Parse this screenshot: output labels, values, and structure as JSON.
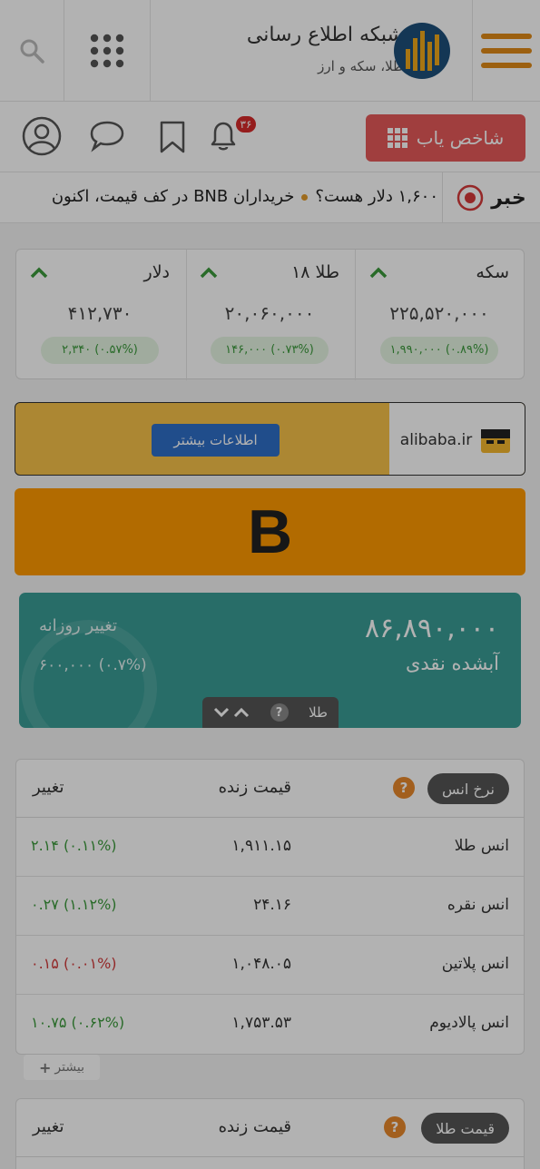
{
  "header": {
    "title": "شبکه اطلاع رسانی",
    "subtitle": "طلا، سکه و ارز"
  },
  "toolbar": {
    "finder_label": "شاخص یاب",
    "notif_count": "۳۶"
  },
  "ticker": {
    "label": "خبر",
    "headline_1": "۱,۶۰۰ دلار هست؟",
    "headline_2": "خریداران BNB در کف قیمت، اکنون"
  },
  "summary": [
    {
      "name": "سکه",
      "value": "۲۲۵,۵۲۰,۰۰۰",
      "change": "۱,۹۹۰,۰۰۰ (۰.۸۹%)"
    },
    {
      "name": "طلا ۱۸",
      "value": "۲۰,۰۶۰,۰۰۰",
      "change": "۱۴۶,۰۰۰ (۰.۷۳%)"
    },
    {
      "name": "دلار",
      "value": "۴۱۲,۷۳۰",
      "change": "۲,۳۴۰ (۰.۵۷%)"
    }
  ],
  "ad": {
    "brand": "alibaba.ir",
    "button": "اطلاعات بیشتر"
  },
  "banner": {
    "letter": "B"
  },
  "highlight": {
    "value": "۸۶,۸۹۰,۰۰۰",
    "name": "آبشده نقدی",
    "change_label": "تغییر روزانه",
    "change_value": "۶۰۰,۰۰۰ (۰.۷%)",
    "category": "طلا"
  },
  "ounce_table": {
    "title": "نرخ انس",
    "col_live": "قیمت زنده",
    "col_change": "تغییر",
    "rows": [
      {
        "name": "انس طلا",
        "price": "۱,۹۱۱.۱۵",
        "change": "۲.۱۴ (۰.۱۱%)",
        "dir": "pos"
      },
      {
        "name": "انس نقره",
        "price": "۲۴.۱۶",
        "change": "۰.۲۷ (۱.۱۲%)",
        "dir": "pos"
      },
      {
        "name": "انس پلاتین",
        "price": "۱,۰۴۸.۰۵",
        "change": "۰.۱۵ (۰.۰۱%)",
        "dir": "neg"
      },
      {
        "name": "انس پالادیوم",
        "price": "۱,۷۵۳.۵۳",
        "change": "۱۰.۷۵ (۰.۶۲%)",
        "dir": "pos"
      }
    ]
  },
  "more_label": "بیشتر",
  "gold_table": {
    "title": "قیمت طلا",
    "col_live": "قیمت زنده",
    "col_change": "تغییر"
  },
  "colors": {
    "accent_red": "#e55a5a",
    "teal": "#3a9c96",
    "banner": "#ff9a00",
    "positive": "#3c9a3c",
    "negative": "#d23a3a"
  }
}
